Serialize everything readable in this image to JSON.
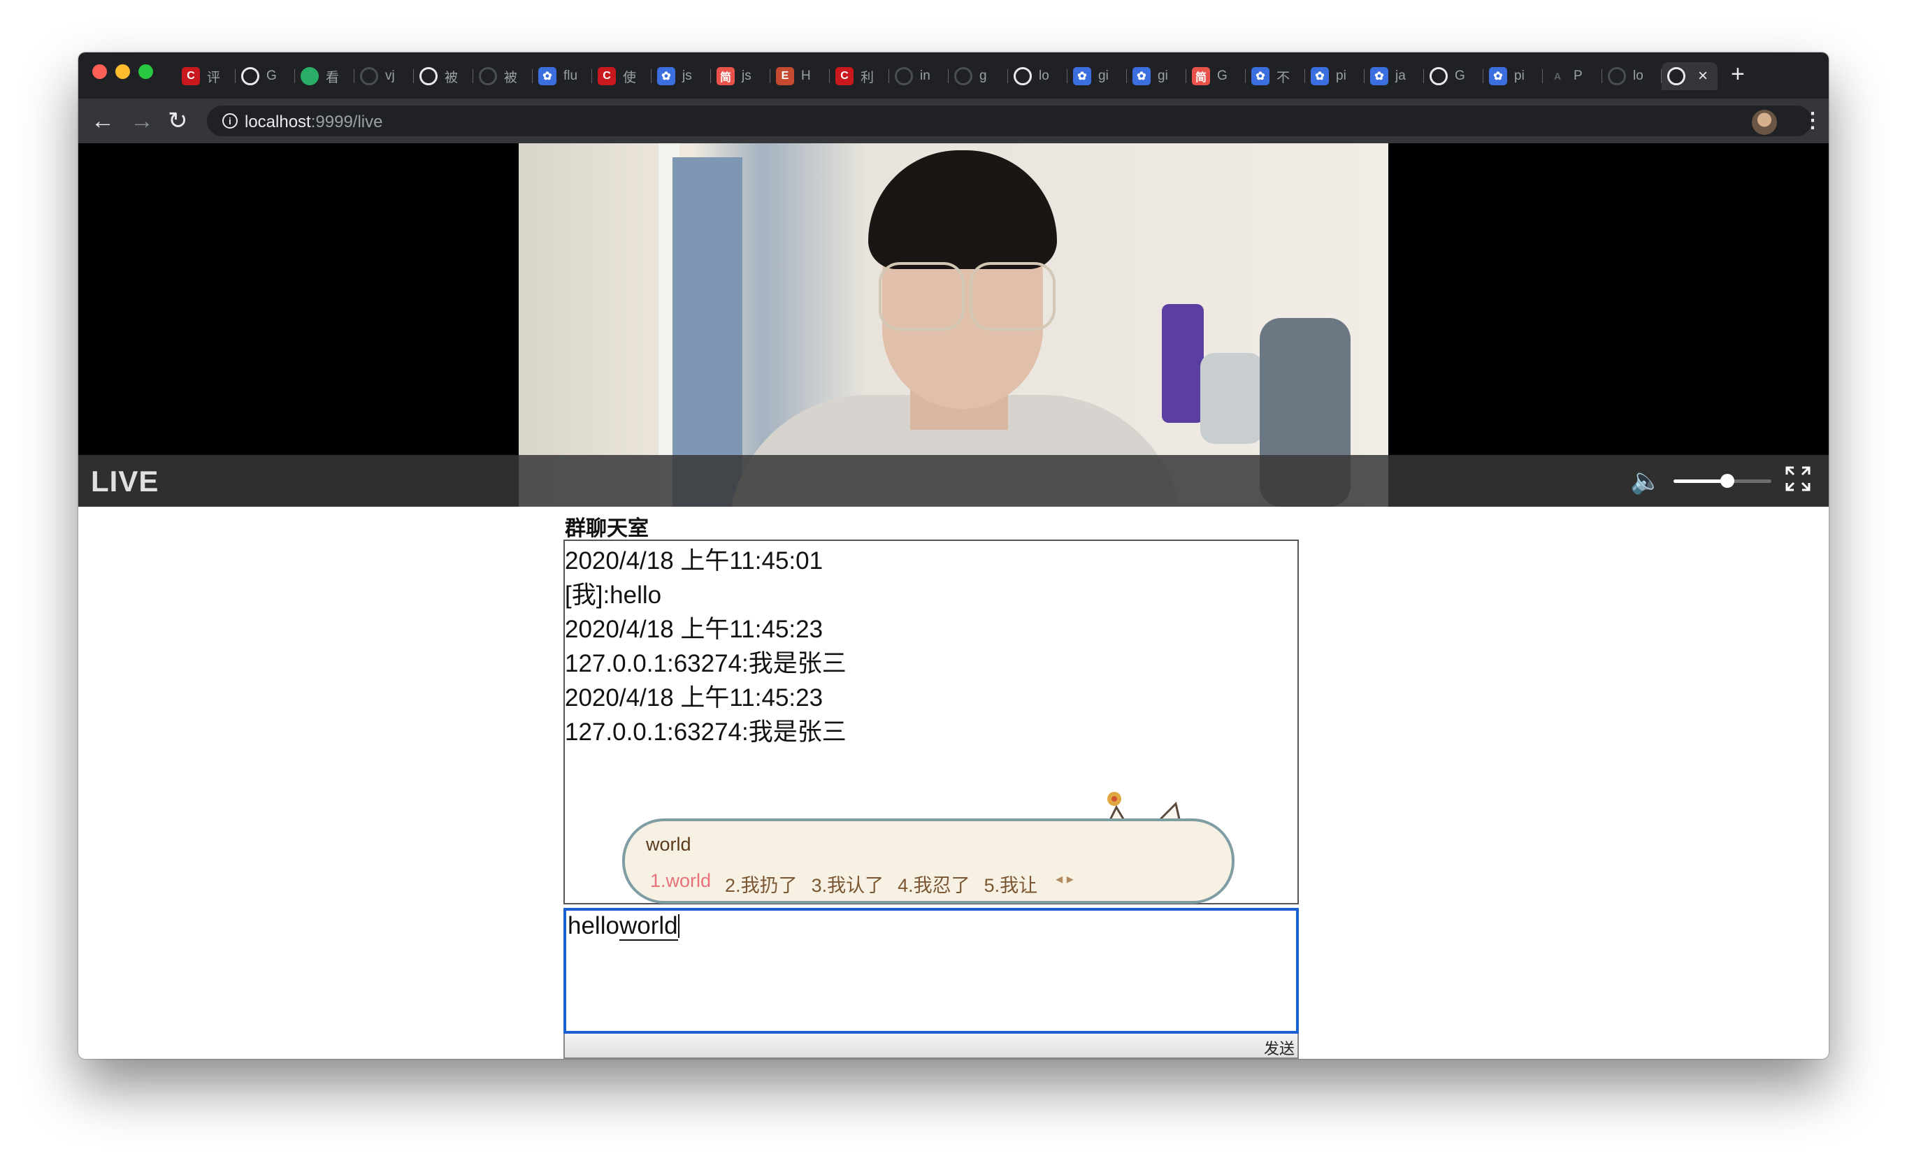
{
  "browser": {
    "tabs": [
      {
        "icon": "csdn-icon",
        "label": "评"
      },
      {
        "icon": "github-icon",
        "label": "G"
      },
      {
        "icon": "wechat-icon",
        "label": "看"
      },
      {
        "icon": "globe-dim-icon",
        "label": "vj"
      },
      {
        "icon": "globe-icon",
        "label": "被"
      },
      {
        "icon": "globe-dim-icon",
        "label": "被"
      },
      {
        "icon": "baidu-icon",
        "label": "flu"
      },
      {
        "icon": "csdn-icon",
        "label": "使"
      },
      {
        "icon": "baidu-icon",
        "label": "js"
      },
      {
        "icon": "jianshu-icon",
        "label": "js"
      },
      {
        "icon": "e-icon",
        "label": "H"
      },
      {
        "icon": "csdn-icon",
        "label": "利"
      },
      {
        "icon": "globe-dim-icon",
        "label": "in"
      },
      {
        "icon": "globe-dim-icon",
        "label": "g"
      },
      {
        "icon": "globe-icon",
        "label": "lo"
      },
      {
        "icon": "baidu-icon",
        "label": "gi"
      },
      {
        "icon": "baidu-icon",
        "label": "gi"
      },
      {
        "icon": "jianshu-icon",
        "label": "G"
      },
      {
        "icon": "baidu-icon",
        "label": "不"
      },
      {
        "icon": "baidu-icon",
        "label": "pi"
      },
      {
        "icon": "baidu-icon",
        "label": "ja"
      },
      {
        "icon": "github-icon",
        "label": "G"
      },
      {
        "icon": "baidu-icon",
        "label": "pi"
      },
      {
        "icon": "ai-icon",
        "label": "P"
      },
      {
        "icon": "globe-dim-icon",
        "label": "lo"
      }
    ],
    "active_tab_close": "×",
    "new_tab": "+",
    "url_host": "localhost",
    "url_path": ":9999/live"
  },
  "player": {
    "live_label": "LIVE",
    "volume_level": 0.55
  },
  "chat": {
    "title": "群聊天室",
    "messages": [
      "2020/4/18 上午11:45:01",
      "[我]:hello",
      "2020/4/18 上午11:45:23",
      "127.0.0.1:63274:我是张三",
      "2020/4/18 上午11:45:23",
      "127.0.0.1:63274:我是张三"
    ],
    "input_committed": "hello",
    "input_composing": "world",
    "send_label": "发送"
  },
  "ime": {
    "typed": "world",
    "candidates": [
      "1.world",
      "2.我扔了",
      "3.我认了",
      "4.我忍了",
      "5.我让"
    ],
    "arrows": "◂ ▸"
  }
}
